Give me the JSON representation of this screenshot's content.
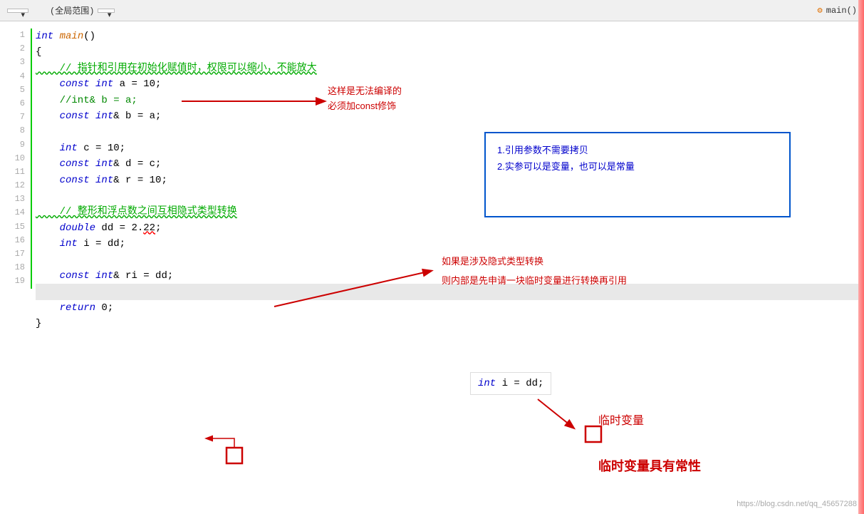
{
  "topbar": {
    "dropdown1": "▼",
    "scope": "(全局范围)",
    "dropdown2": "▼",
    "func": "main()",
    "gear": "⚙"
  },
  "code": {
    "line1": "int main()",
    "line2": "{",
    "line3": "    // 指针和引用在初始化赋值时，权限可以缩小，不能放大",
    "line4": "    const int a = 10;",
    "line5": "    //int& b = a;",
    "line6": "    const int& b = a;",
    "line7": "",
    "line8": "    int c = 10;",
    "line9": "    const int& d = c;",
    "line10": "    const int& r = 10;",
    "line11": "",
    "line12": "    // 整形和浮点数之间互相隐式类型转换",
    "line13": "    double dd = 2.22;",
    "line14": "    int i = dd;",
    "line15": "",
    "line16": "    const int& ri = dd;",
    "line17": "",
    "line18": "    return 0;",
    "line19": "}"
  },
  "annotations": {
    "arrow1_label1": "这样是无法编译的",
    "arrow1_label2": "必须加const修饰",
    "box1_line1": "1.引用参数不需要拷贝",
    "box1_line2": "2.实参可以是变量，也可以是常量",
    "arrow2_label1": "如果是涉及隐式类型转换",
    "arrow2_label2": "则内部是先申请一块临时变量进行转换再引用",
    "temp_var_label": "临时变量",
    "temp_var_label2": "临时变量具有常性",
    "code_popup": "int  i  =  dd;"
  },
  "watermark": "https://blog.csdn.net/qq_45657288"
}
